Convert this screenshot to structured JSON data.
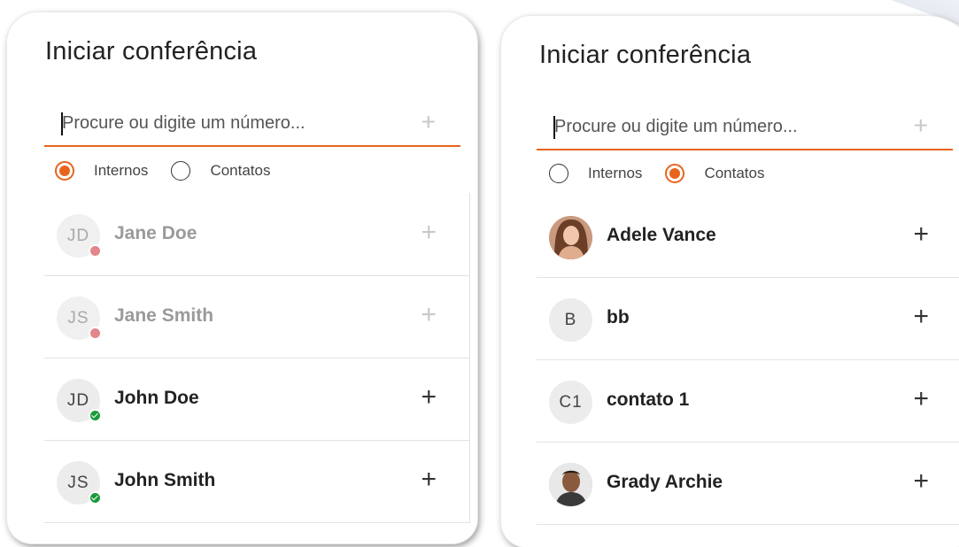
{
  "panels": [
    {
      "title": "Iniciar conferência",
      "search_placeholder": "Procure ou digite um número...",
      "scope": {
        "internal": "Internos",
        "contacts": "Contatos",
        "selected": "internal"
      },
      "rows": [
        {
          "initials": "JD",
          "name": "Jane Doe",
          "status": "away"
        },
        {
          "initials": "JS",
          "name": "Jane Smith",
          "status": "away"
        },
        {
          "initials": "JD",
          "name": "John Doe",
          "status": "available"
        },
        {
          "initials": "JS",
          "name": "John Smith",
          "status": "available"
        }
      ]
    },
    {
      "title": "Iniciar conferência",
      "search_placeholder": "Procure ou digite um número...",
      "scope": {
        "internal": "Internos",
        "contacts": "Contatos",
        "selected": "contacts"
      },
      "rows": [
        {
          "initials": "",
          "name": "Adele Vance",
          "avatar": "photo"
        },
        {
          "initials": "B",
          "name": "bb"
        },
        {
          "initials": "C1",
          "name": "contato 1"
        },
        {
          "initials": "",
          "name": "Grady Archie",
          "avatar": "photo"
        }
      ]
    }
  ],
  "icons": {
    "add": "plus-icon",
    "radio": "radio-icon",
    "status": "presence-dot-icon"
  },
  "colors": {
    "accent": "#e8641c",
    "away": "#e2868a",
    "available": "#1a9a3a"
  }
}
